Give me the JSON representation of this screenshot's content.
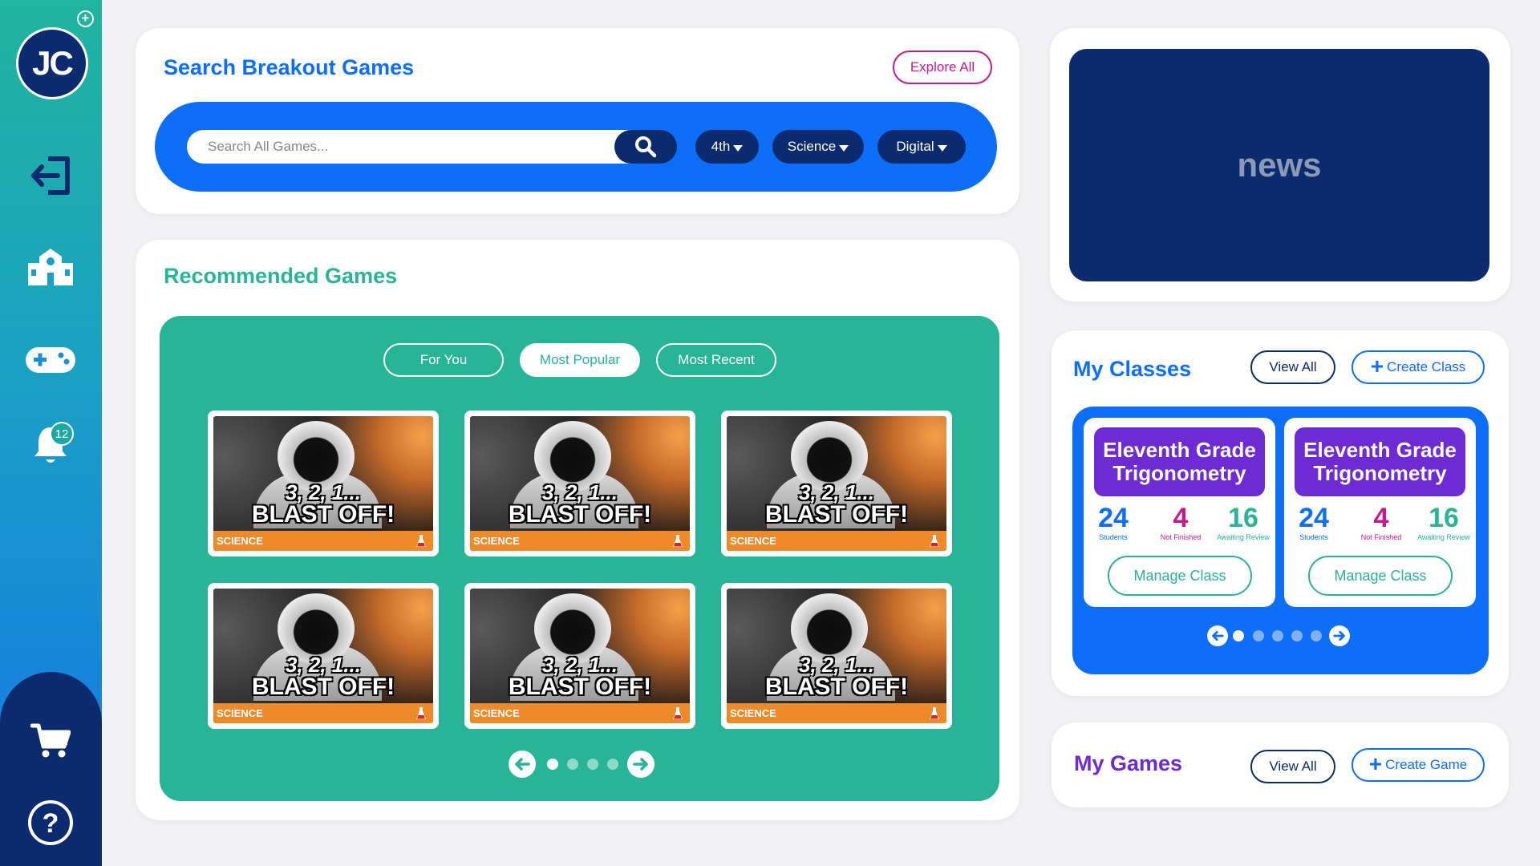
{
  "sidebar": {
    "avatar_initials": "JC",
    "avatar_add": "+",
    "items": [
      {
        "name": "logout-icon"
      },
      {
        "name": "school-icon"
      },
      {
        "name": "gamepad-icon"
      },
      {
        "name": "bell-icon"
      }
    ],
    "notification_count": "12",
    "bottom_items": [
      {
        "name": "cart-icon"
      },
      {
        "name": "help-icon"
      }
    ]
  },
  "search": {
    "title": "Search Breakout Games",
    "explore_label": "Explore All",
    "placeholder": "Search All Games...",
    "filters": [
      "4th",
      "Science",
      "Digital"
    ]
  },
  "recommended": {
    "title": "Recommended Games",
    "tabs": [
      "For You",
      "Most Popular",
      "Most Recent"
    ],
    "active_tab": "Most Popular",
    "games": [
      {
        "title_line1": "3, 2, 1...",
        "title_line2": "BLAST OFF!",
        "subject": "SCIENCE"
      },
      {
        "title_line1": "3, 2, 1...",
        "title_line2": "BLAST OFF!",
        "subject": "SCIENCE"
      },
      {
        "title_line1": "3, 2, 1...",
        "title_line2": "BLAST OFF!",
        "subject": "SCIENCE"
      },
      {
        "title_line1": "3, 2, 1...",
        "title_line2": "BLAST OFF!",
        "subject": "SCIENCE"
      },
      {
        "title_line1": "3, 2, 1...",
        "title_line2": "BLAST OFF!",
        "subject": "SCIENCE"
      },
      {
        "title_line1": "3, 2, 1...",
        "title_line2": "BLAST OFF!",
        "subject": "SCIENCE"
      }
    ],
    "pagination": {
      "pages": 4,
      "current": 1
    }
  },
  "news": {
    "label": "news"
  },
  "classes": {
    "title": "My Classes",
    "view_all_label": "View All",
    "create_label": "Create Class",
    "cards": [
      {
        "name": "Eleventh Grade Trigonometry",
        "students": "24",
        "students_label": "Students",
        "not_finished": "4",
        "not_finished_label": "Not Finished",
        "awaiting": "16",
        "awaiting_label": "Awaiting Review",
        "manage_label": "Manage Class"
      },
      {
        "name": "Eleventh Grade Trigonometry",
        "students": "24",
        "students_label": "Students",
        "not_finished": "4",
        "not_finished_label": "Not Finished",
        "awaiting": "16",
        "awaiting_label": "Awaiting Review",
        "manage_label": "Manage Class"
      }
    ],
    "pagination": {
      "pages": 5,
      "current": 1
    }
  },
  "games": {
    "title": "My Games",
    "view_all_label": "View All",
    "create_label": "Create Game"
  },
  "colors": {
    "primary_blue": "#0d6ef8",
    "navy": "#0b2b6e",
    "teal": "#27b497",
    "purple": "#6e2bd3",
    "magenta": "#c4198f",
    "orange": "#ef8a2a"
  }
}
